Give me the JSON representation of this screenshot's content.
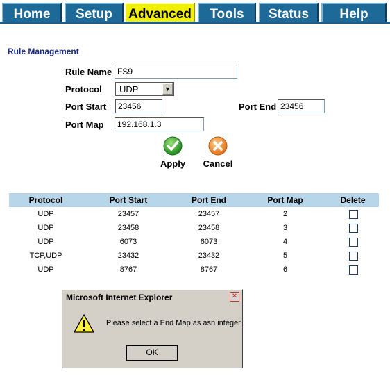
{
  "nav": {
    "tabs": [
      {
        "label": "Home"
      },
      {
        "label": "Setup"
      },
      {
        "label": "Advanced",
        "active": true
      },
      {
        "label": "Tools"
      },
      {
        "label": "Status"
      },
      {
        "label": "Help"
      }
    ]
  },
  "form": {
    "section_title": "Rule Management",
    "rule_name_label": "Rule Name",
    "rule_name_value": "FS9",
    "protocol_label": "Protocol",
    "protocol_value": "UDP",
    "port_start_label": "Port Start",
    "port_start_value": "23456",
    "port_end_label": "Port End",
    "port_end_value": "23456",
    "port_map_label": "Port Map",
    "port_map_value": "192.168.1.3",
    "apply_label": "Apply",
    "cancel_label": "Cancel"
  },
  "table": {
    "headers": [
      "Protocol",
      "Port Start",
      "Port End",
      "Port Map",
      "Delete"
    ],
    "rows": [
      {
        "protocol": "UDP",
        "port_start": "23457",
        "port_end": "23457",
        "port_map": "2"
      },
      {
        "protocol": "UDP",
        "port_start": "23458",
        "port_end": "23458",
        "port_map": "3"
      },
      {
        "protocol": "UDP",
        "port_start": "6073",
        "port_end": "6073",
        "port_map": "4"
      },
      {
        "protocol": "TCP,UDP",
        "port_start": "23432",
        "port_end": "23432",
        "port_map": "5"
      },
      {
        "protocol": "UDP",
        "port_start": "8767",
        "port_end": "8767",
        "port_map": "6"
      }
    ]
  },
  "dialog": {
    "title": "Microsoft Internet Explorer",
    "message": "Please select a End Map as asn integer",
    "ok_label": "OK",
    "close_glyph": "×"
  },
  "colors": {
    "tab_bg": "#1d6a98",
    "tab_active_bg": "#f0f000",
    "table_header_bg": "#b8d6ea",
    "section_title": "#1a2a80"
  },
  "icons": {
    "apply": "green-checkmark-icon",
    "cancel": "orange-x-icon",
    "dialog_warning": "warning-triangle-icon"
  }
}
